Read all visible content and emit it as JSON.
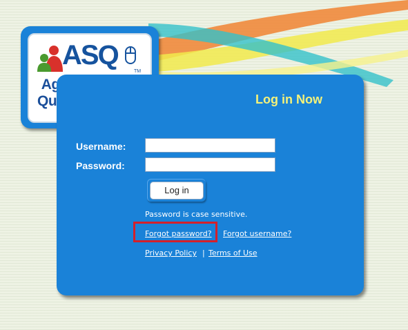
{
  "logo": {
    "brand": "ASQ",
    "trademark": "TM",
    "line1": "Ages & Stages",
    "line2": "Questionnaires",
    "registered": "®"
  },
  "login": {
    "title": "Log in Now",
    "username_label": "Username:",
    "password_label": "Password:",
    "username_value": "",
    "password_value": "",
    "login_button": "Log in",
    "case_hint": "Password is case sensitive.",
    "forgot_password": "Forgot password?",
    "forgot_username": "Forgot username?",
    "privacy_policy": "Privacy Policy",
    "separator": "|",
    "terms_of_use": "Terms of Use"
  },
  "colors": {
    "panel": "#1a82d8",
    "title": "#f4f27a",
    "highlight": "#d4202a",
    "swoosh_orange": "#f08a3c",
    "swoosh_yellow": "#f1ea4c",
    "swoosh_teal": "#35c0c9"
  },
  "icons": [
    "people-icon",
    "computer-mouse-icon"
  ]
}
